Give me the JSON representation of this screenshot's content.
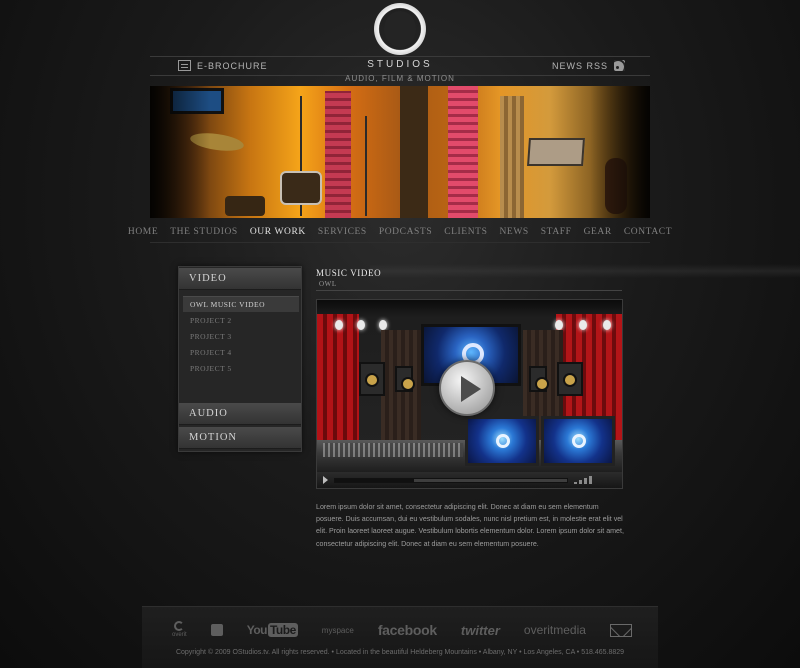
{
  "header": {
    "logo_text": "STUDIOS",
    "tagline": "AUDIO, FILM & MOTION",
    "ebrochure_label": "E-BROCHURE",
    "rss_label": "NEWS RSS"
  },
  "nav": {
    "items": [
      {
        "label": "HOME"
      },
      {
        "label": "THE STUDIOS"
      },
      {
        "label": "OUR WORK"
      },
      {
        "label": "SERVICES"
      },
      {
        "label": "PODCASTS"
      },
      {
        "label": "CLIENTS"
      },
      {
        "label": "NEWS"
      },
      {
        "label": "STAFF"
      },
      {
        "label": "GEAR"
      },
      {
        "label": "CONTACT"
      }
    ],
    "active": "OUR WORK"
  },
  "sidebar": {
    "video_label": "VIDEO",
    "items": [
      {
        "label": "OWL MUSIC VIDEO"
      },
      {
        "label": "PROJECT 2"
      },
      {
        "label": "PROJECT 3"
      },
      {
        "label": "PROJECT 4"
      },
      {
        "label": "PROJECT 5"
      }
    ],
    "audio_label": "AUDIO",
    "motion_label": "MOTION"
  },
  "main": {
    "title": "MUSIC VIDEO",
    "subtitle": "OWL",
    "player": {
      "progress": 0.34
    },
    "body_text": "Lorem ipsum dolor sit amet, consectetur adipiscing elit. Donec at diam eu sem elementum posuere. Duis accumsan, dui eu vestibulum sodales, nunc nisl pretium est, in molestie erat elit vel elit. Proin laoreet laoreet augue. Vestibulum lobortis elementum dolor. Lorem ipsum dolor sit amet, consectetur adipiscing elit. Donec at diam eu sem elementum posuere."
  },
  "footer": {
    "overit_label": "overit",
    "youtube_you": "You",
    "youtube_tube": "Tube",
    "myspace_label": "myspace",
    "facebook_label": "facebook",
    "twitter_label": "twitter",
    "overitmedia_label": "overitmedia",
    "copyright": "Copyright © 2009 OStudios.tv. All rights reserved. • Located in the beautiful Heldeberg Mountains • Albany, NY • Los Angeles, CA • 518.465.8829"
  }
}
